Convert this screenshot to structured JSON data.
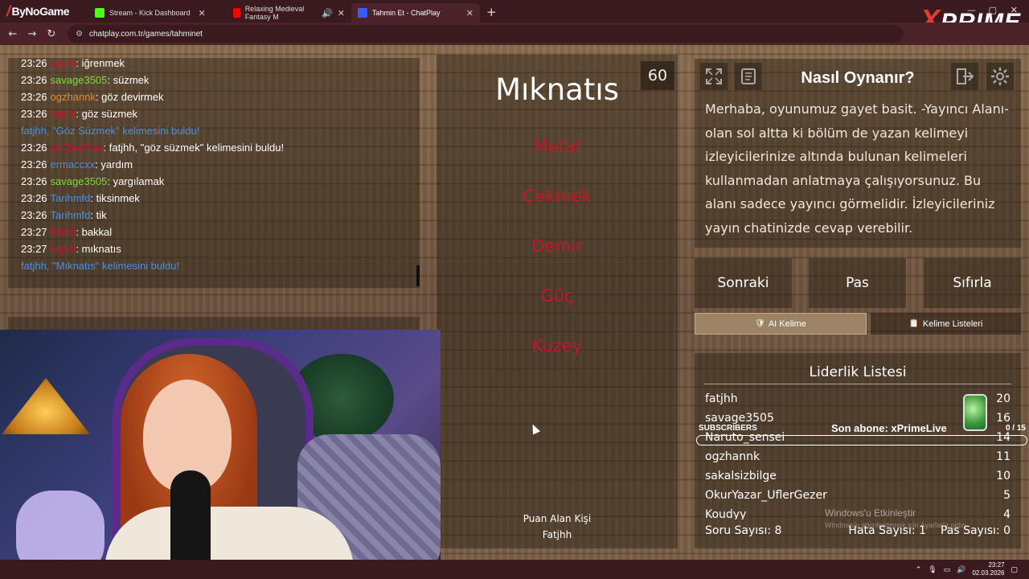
{
  "browser": {
    "brand": "ByNoGame",
    "tabs": [
      {
        "title": "Stream - Kick Dashboard",
        "favicon_color": "#53fc18"
      },
      {
        "title": "Relaxing Medieval Fantasy M",
        "favicon_color": "#ff0000"
      },
      {
        "title": "Tahmin Et - ChatPlay",
        "favicon_color": "#3d5afe"
      }
    ],
    "new_tab": "+",
    "url": "chatplay.com.tr/games/tahminet",
    "overlay_logo_x": "X",
    "overlay_logo_text": "PRIME"
  },
  "chat": {
    "messages": [
      {
        "time": "23:26",
        "user": "fatjhh",
        "color": "#c0182a",
        "text": ": iğrenmek"
      },
      {
        "time": "23:26",
        "user": "savage3505",
        "color": "#7cdc3a",
        "text": ": süzmek"
      },
      {
        "time": "23:26",
        "user": "ogzhannk",
        "color": "#e8872a",
        "text": ": göz devirmek"
      },
      {
        "time": "23:26",
        "user": "fatjhh",
        "color": "#c0182a",
        "text": ": göz süzmek"
      },
      {
        "system": true,
        "text": "fatjhh, \"Göz Süzmek\" kelimesini buldu!"
      },
      {
        "time": "23:26",
        "user": "@ChatPlay",
        "color": "#c0182a",
        "text": ": fatjhh, \"göz süzmek\" kelimesini buldu!"
      },
      {
        "time": "23:26",
        "user": "ermaccxx",
        "color": "#4a8fe0",
        "text": ": yardım"
      },
      {
        "time": "23:26",
        "user": "savage3505",
        "color": "#7cdc3a",
        "text": ": yargılamak"
      },
      {
        "time": "23:26",
        "user": "Tarihmfd",
        "color": "#4a8fe0",
        "text": ": tiksinmek"
      },
      {
        "time": "23:26",
        "user": "Tarihmfd",
        "color": "#4a8fe0",
        "text": ": tik"
      },
      {
        "time": "23:27",
        "user": "fatjhh",
        "color": "#c0182a",
        "text": ": bakkal"
      },
      {
        "time": "23:27",
        "user": "fatjhh",
        "color": "#c0182a",
        "text": ": mıknatıs"
      },
      {
        "system": true,
        "text": "fatjhh, \"Mıknatıs\" kelimesini buldu!"
      }
    ]
  },
  "game": {
    "timer": "60",
    "word": "Mıknatıs",
    "taboo_words": [
      "Metal",
      "Çekmek",
      "Demir",
      "Güç",
      "Kuzey"
    ],
    "scorer_label": "Puan Alan Kişi",
    "scorer_name": "Fatjhh"
  },
  "howto": {
    "title": "Nasıl Oynanır?",
    "text": "Merhaba, oyunumuz gayet basit. -Yayıncı Alanı- olan sol altta ki bölüm de yazan kelimeyi izleyicilerinize altında bulunan kelimeleri kullanmadan anlatmaya çalışıyorsunuz. Bu alanı sadece yayıncı görmelidir. İzleyicileriniz yayın chatinizde cevap verebilir."
  },
  "controls": {
    "next": "Sonraki",
    "pass": "Pas",
    "reset": "Sıfırla",
    "ai_word": "AI Kelime",
    "word_lists": "Kelime Listeleri"
  },
  "leaderboard": {
    "title": "Liderlik Listesi",
    "rows": [
      {
        "name": "fatjhh",
        "score": "20"
      },
      {
        "name": "savage3505",
        "score": "16"
      },
      {
        "name": "Naruto_sensei",
        "score": "14"
      },
      {
        "name": "ogzhannk",
        "score": "11"
      },
      {
        "name": "sakalsizbilge",
        "score": "10"
      },
      {
        "name": "OkurYazar_UflerGezer",
        "score": "5"
      },
      {
        "name": "Koudyy",
        "score": "4"
      }
    ],
    "question_count": "Soru Sayısı: 8",
    "error_count": "Hata Sayısı: 1",
    "pass_count": "Pas Sayısı: 0"
  },
  "overlay": {
    "subs_label": "SUBSCRIBERS",
    "last_sub": "Son abone: xPrimeLive",
    "sub_count": "0 / 15",
    "win_activate": "Windows'u Etkinleştir",
    "win_activate_sub": "Windows'u etkinleştirmek için Ayarlar'a gidin."
  },
  "taskbar": {
    "time": "23:27",
    "date": "02.03.2026"
  }
}
